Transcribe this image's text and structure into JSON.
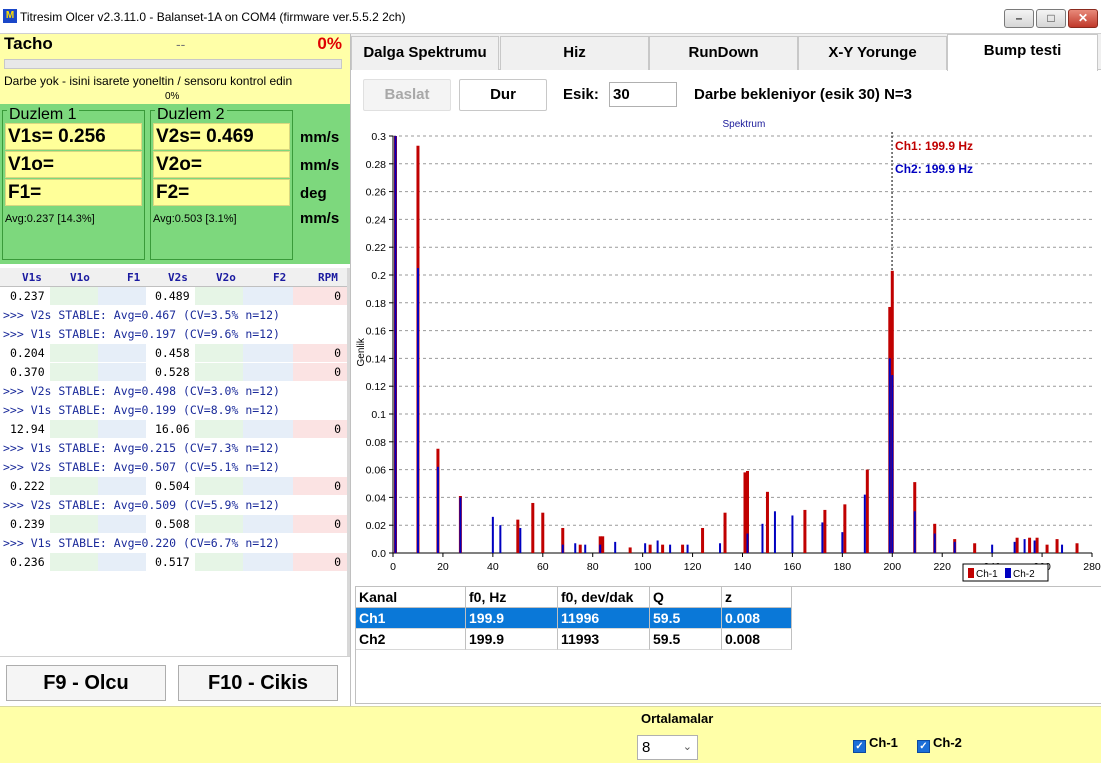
{
  "window": {
    "title": "Titresim Olcer v2.3.11.0 - Balanset-1A on COM4 (firmware ver.5.5.2 2ch)",
    "icon_label": "M"
  },
  "tacho": {
    "label": "Tacho",
    "value": "--",
    "percent": "0%",
    "progress": 0,
    "message": "Darbe yok - isini isarete yoneltin / sensoru kontrol edin",
    "small_percent": "0%"
  },
  "planes": [
    {
      "title": "Duzlem 1",
      "s": "V1s= 0.256",
      "o": "V1o=",
      "f": "F1=",
      "avg": "Avg:0.237 [14.3%]"
    },
    {
      "title": "Duzlem 2",
      "s": "V2s= 0.469",
      "o": "V2o=",
      "f": "F2=",
      "avg": "Avg:0.503 [3.1%]"
    }
  ],
  "units": [
    "mm/s",
    "mm/s",
    "deg",
    "mm/s"
  ],
  "table": {
    "headers": [
      "V1s",
      "V1o",
      "F1",
      "V2s",
      "V2o",
      "F2",
      "RPM"
    ],
    "rows": [
      {
        "type": "data",
        "v1s": "0.237",
        "v2s": "0.489",
        "rpm": "0"
      },
      {
        "type": "msg",
        "text": ">>> V2s STABLE: Avg=0.467 (CV=3.5% n=12)"
      },
      {
        "type": "msg",
        "text": ">>> V1s STABLE: Avg=0.197 (CV=9.6% n=12)"
      },
      {
        "type": "data",
        "v1s": "0.204",
        "v2s": "0.458",
        "rpm": "0"
      },
      {
        "type": "data",
        "v1s": "0.370",
        "v2s": "0.528",
        "rpm": "0"
      },
      {
        "type": "msg",
        "text": ">>> V2s STABLE: Avg=0.498 (CV=3.0% n=12)"
      },
      {
        "type": "msg",
        "text": ">>> V1s STABLE: Avg=0.199 (CV=8.9% n=12)"
      },
      {
        "type": "data",
        "v1s": "12.94",
        "v2s": "16.06",
        "rpm": "0"
      },
      {
        "type": "msg",
        "text": ">>> V1s STABLE: Avg=0.215 (CV=7.3% n=12)"
      },
      {
        "type": "msg",
        "text": ">>> V2s STABLE: Avg=0.507 (CV=5.1% n=12)"
      },
      {
        "type": "data",
        "v1s": "0.222",
        "v2s": "0.504",
        "rpm": "0"
      },
      {
        "type": "msg",
        "text": ">>> V2s STABLE: Avg=0.509 (CV=5.9% n=12)"
      },
      {
        "type": "data",
        "v1s": "0.239",
        "v2s": "0.508",
        "rpm": "0"
      },
      {
        "type": "msg",
        "text": ">>> V1s STABLE: Avg=0.220 (CV=6.7% n=12)"
      },
      {
        "type": "data",
        "v1s": "0.236",
        "v2s": "0.517",
        "rpm": "0"
      }
    ]
  },
  "buttons": {
    "f9": "F9 - Olcu",
    "f10": "F10 - Cikis"
  },
  "tabs": [
    {
      "label": "Dalga Spektrumu",
      "active": false
    },
    {
      "label": "Hiz",
      "active": false
    },
    {
      "label": "RunDown",
      "active": false
    },
    {
      "label": "X-Y Yorunge",
      "active": false
    },
    {
      "label": "Bump testi",
      "active": true
    }
  ],
  "toolbar": {
    "start": "Baslat",
    "stop": "Dur",
    "threshold_label": "Esik:",
    "threshold_value": "30",
    "status": "Darbe bekleniyor (esik 30)  N=3"
  },
  "chart_data": {
    "type": "bar",
    "title": "Spektrum",
    "xlabel": "",
    "ylabel": "Genlik",
    "xlim": [
      0,
      280
    ],
    "ylim": [
      0,
      0.3
    ],
    "xticks": [
      0,
      20,
      40,
      60,
      80,
      100,
      120,
      140,
      160,
      180,
      200,
      220,
      240,
      260,
      280
    ],
    "yticks": [
      0.0,
      0.02,
      0.04,
      0.06,
      0.08,
      0.1,
      0.12,
      0.14,
      0.16,
      0.18,
      0.2,
      0.22,
      0.24,
      0.26,
      0.28,
      0.3
    ],
    "grid": true,
    "legend": "bottom-right",
    "cursor_x": 199.9,
    "annotations": [
      {
        "text": "Ch1: 199.9 Hz",
        "color": "#c00000"
      },
      {
        "text": "Ch2: 199.9 Hz",
        "color": "#0000c0"
      }
    ],
    "series": [
      {
        "name": "Ch-1",
        "color": "#c00000",
        "points": [
          [
            1,
            0.3
          ],
          [
            10,
            0.293
          ],
          [
            18,
            0.075
          ],
          [
            27,
            0.041
          ],
          [
            50,
            0.024
          ],
          [
            56,
            0.036
          ],
          [
            60,
            0.029
          ],
          [
            68,
            0.018
          ],
          [
            75,
            0.006
          ],
          [
            83,
            0.012
          ],
          [
            84,
            0.012
          ],
          [
            95,
            0.004
          ],
          [
            103,
            0.006
          ],
          [
            108,
            0.006
          ],
          [
            116,
            0.006
          ],
          [
            124,
            0.018
          ],
          [
            133,
            0.029
          ],
          [
            141,
            0.058
          ],
          [
            142,
            0.059
          ],
          [
            150,
            0.044
          ],
          [
            165,
            0.031
          ],
          [
            173,
            0.031
          ],
          [
            181,
            0.035
          ],
          [
            190,
            0.06
          ],
          [
            199,
            0.177
          ],
          [
            200,
            0.203
          ],
          [
            209,
            0.051
          ],
          [
            217,
            0.021
          ],
          [
            225,
            0.01
          ],
          [
            233,
            0.007
          ],
          [
            250,
            0.011
          ],
          [
            255,
            0.011
          ],
          [
            258,
            0.011
          ],
          [
            262,
            0.006
          ],
          [
            266,
            0.01
          ],
          [
            274,
            0.007
          ]
        ]
      },
      {
        "name": "Ch-2",
        "color": "#0000c0",
        "points": [
          [
            1,
            0.3
          ],
          [
            10,
            0.205
          ],
          [
            18,
            0.062
          ],
          [
            27,
            0.04
          ],
          [
            40,
            0.026
          ],
          [
            43,
            0.02
          ],
          [
            51,
            0.018
          ],
          [
            68,
            0.006
          ],
          [
            73,
            0.007
          ],
          [
            77,
            0.006
          ],
          [
            83,
            0.006
          ],
          [
            89,
            0.008
          ],
          [
            101,
            0.007
          ],
          [
            106,
            0.009
          ],
          [
            111,
            0.006
          ],
          [
            118,
            0.006
          ],
          [
            131,
            0.007
          ],
          [
            142,
            0.014
          ],
          [
            148,
            0.021
          ],
          [
            153,
            0.03
          ],
          [
            160,
            0.027
          ],
          [
            172,
            0.022
          ],
          [
            180,
            0.015
          ],
          [
            189,
            0.042
          ],
          [
            199,
            0.14
          ],
          [
            200,
            0.128
          ],
          [
            209,
            0.03
          ],
          [
            217,
            0.014
          ],
          [
            225,
            0.008
          ],
          [
            240,
            0.006
          ],
          [
            249,
            0.008
          ],
          [
            253,
            0.01
          ],
          [
            257,
            0.009
          ],
          [
            268,
            0.006
          ]
        ]
      }
    ]
  },
  "results": {
    "headers": [
      "Kanal",
      "f0, Hz",
      "f0, dev/dak",
      "Q",
      "z"
    ],
    "rows": [
      [
        "Ch1",
        "199.9",
        "11996",
        "59.5",
        "0.008"
      ],
      [
        "Ch2",
        "199.9",
        "11993",
        "59.5",
        "0.008"
      ]
    ],
    "selected_row": 0
  },
  "footer": {
    "averages_label": "Ortalamalar",
    "averages_value": "8",
    "checkboxes": [
      {
        "label": "Ch-1",
        "checked": true
      },
      {
        "label": "Ch-2",
        "checked": true
      }
    ]
  },
  "colors": {
    "ch1": "#c00000",
    "ch2": "#0000c0",
    "yellow_panel": "#ffffa8",
    "green_panel": "#7dd87d",
    "selection": "#0a78d8"
  }
}
